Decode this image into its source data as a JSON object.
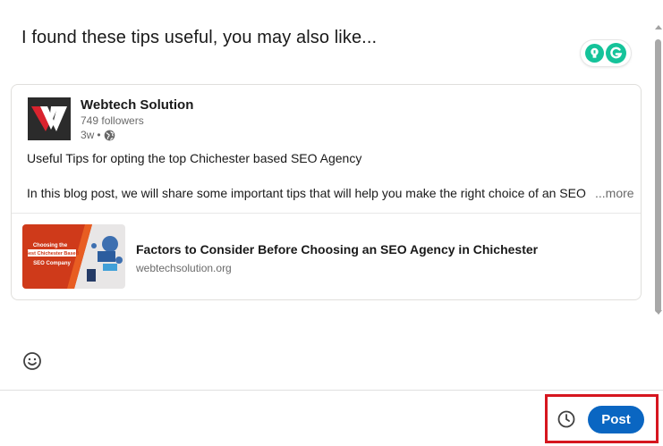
{
  "composer": {
    "text": "I found these tips useful, you may also like..."
  },
  "shared_post": {
    "company_name": "Webtech Solution",
    "followers": "749 followers",
    "age": "3w",
    "separator": "•",
    "title_line": "Useful Tips for opting the top Chichester based SEO Agency",
    "body": "In this blog post, we will share some important tips that will help you make the right choice of an SEO",
    "more_label": "...more",
    "article": {
      "title": "Factors to Consider Before Choosing an SEO Agency in Chichester",
      "domain": "webtechsolution.org",
      "thumbnail_text": [
        "Choosing the",
        "Best Chichester Based",
        "SEO Company"
      ]
    }
  },
  "footer": {
    "post_label": "Post"
  },
  "icons": {
    "grammarly": "grammarly-icon",
    "bulb": "lightbulb-icon",
    "globe": "globe-icon",
    "emoji": "smiley-icon",
    "schedule": "clock-icon"
  },
  "colors": {
    "primary": "#0a66c2",
    "highlight": "#d6161f",
    "grammarly_green": "#15c39a",
    "logo_red": "#d9232e"
  }
}
